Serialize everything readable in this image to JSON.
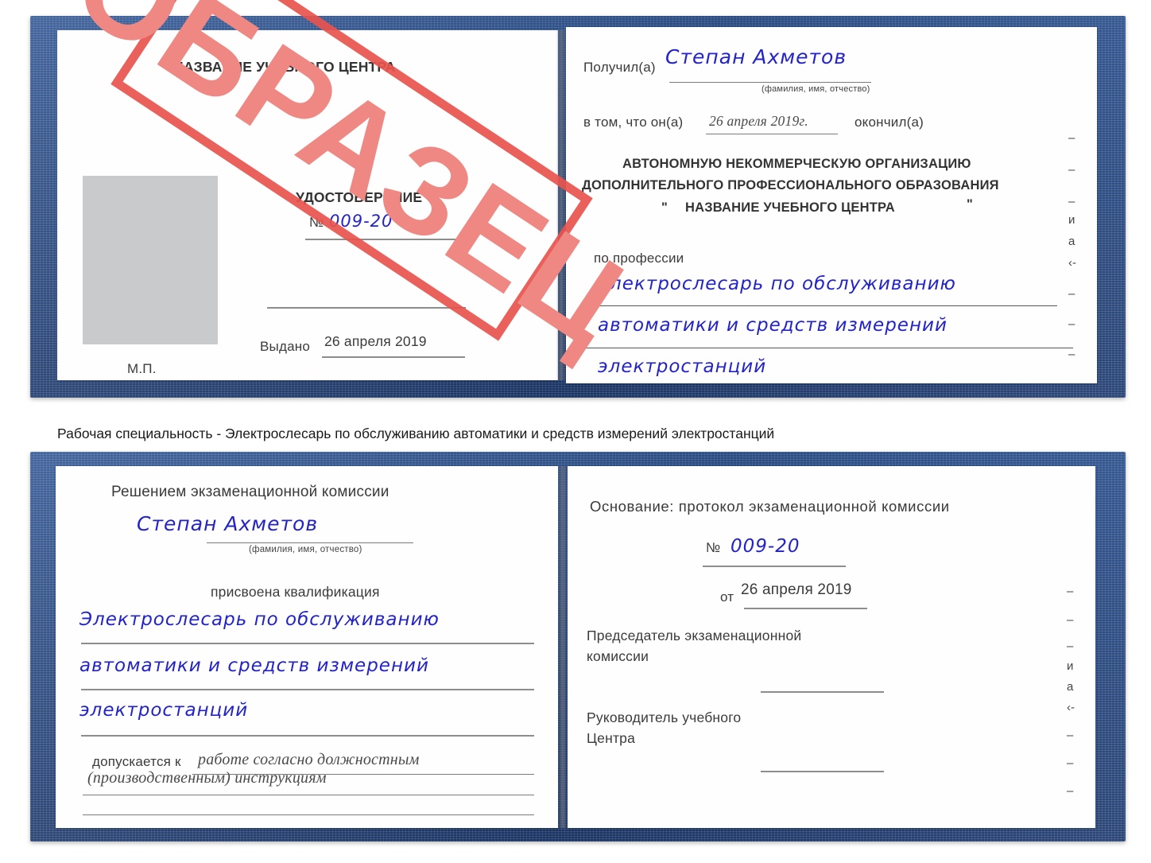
{
  "watermark": {
    "text": "ОБРАЗЕЦ",
    "color": "#ef8882",
    "frame_color": "#e8544e"
  },
  "cover": {
    "color": "#24467f"
  },
  "ink": {
    "handwriting_color": "#2323c8",
    "print_color": "#3b3b3b"
  },
  "certificate_front": {
    "left_page": {
      "org_title": "НАЗВАНИЕ УЧЕБНОГО ЦЕНТРА",
      "doc_type": "УДОСТОВЕРЕНИЕ",
      "number_label": "№",
      "number_value": "009-20",
      "issued_label": "Выдано",
      "issued_value": "26 апреля 2019",
      "seal_label": "М.П.",
      "photo_placeholder": "photo-placeholder"
    },
    "right_page": {
      "received_label": "Получил(а)",
      "received_value": "Степан Ахметов",
      "name_hint": "(фамилия, имя, отчество)",
      "in_that_label": "в том, что он(а)",
      "completion_date": "26 апреля 2019г.",
      "finished_label": "окончил(а)",
      "org_line1": "АВТОНОМНУЮ НЕКОММЕРЧЕСКУЮ ОРГАНИЗАЦИЮ",
      "org_line2": "ДОПОЛНИТЕЛЬНОГО ПРОФЕССИОНАЛЬНОГО ОБРАЗОВАНИЯ",
      "org_quote_open": "\"",
      "org_line3": "НАЗВАНИЕ УЧЕБНОГО ЦЕНТРА",
      "org_quote_close": "\"",
      "profession_label": "по профессии",
      "profession_line1": "Электрослесарь по обслуживанию",
      "profession_line2": "автоматики и средств измерений",
      "profession_line3": "электростанций",
      "edge_fragments": [
        "–",
        "–",
        "–",
        "–",
        "и",
        "а",
        "‹-",
        "–",
        "–",
        "–",
        "–"
      ]
    }
  },
  "caption": "Рабочая специальность - Электрослесарь по обслуживанию автоматики и средств измерений электростанций",
  "certificate_inside": {
    "left_page": {
      "commission_title": "Решением экзаменационной комиссии",
      "name_value": "Степан Ахметов",
      "name_hint": "(фамилия, имя, отчество)",
      "qualification_label": "присвоена квалификация",
      "qualification_line1": "Электрослесарь по обслуживанию",
      "qualification_line2": "автоматики и средств измерений",
      "qualification_line3": "электростанций",
      "allowed_label": "допускается к",
      "allowed_value_line1": "работе согласно должностным",
      "allowed_value_line2": "(производственным) инструкциям"
    },
    "right_page": {
      "basis_label": "Основание: протокол экзаменационной комиссии",
      "protocol_number_label": "№",
      "protocol_number_value": "009-20",
      "protocol_date_label": "от",
      "protocol_date_value": "26 апреля 2019",
      "chairman_line1": "Председатель экзаменационной",
      "chairman_line2": "комиссии",
      "head_line1": "Руководитель учебного",
      "head_line2": "Центра",
      "edge_fragments": [
        "–",
        "–",
        "–",
        "и",
        "а",
        "‹-",
        "–",
        "–",
        "–",
        "–"
      ]
    }
  }
}
